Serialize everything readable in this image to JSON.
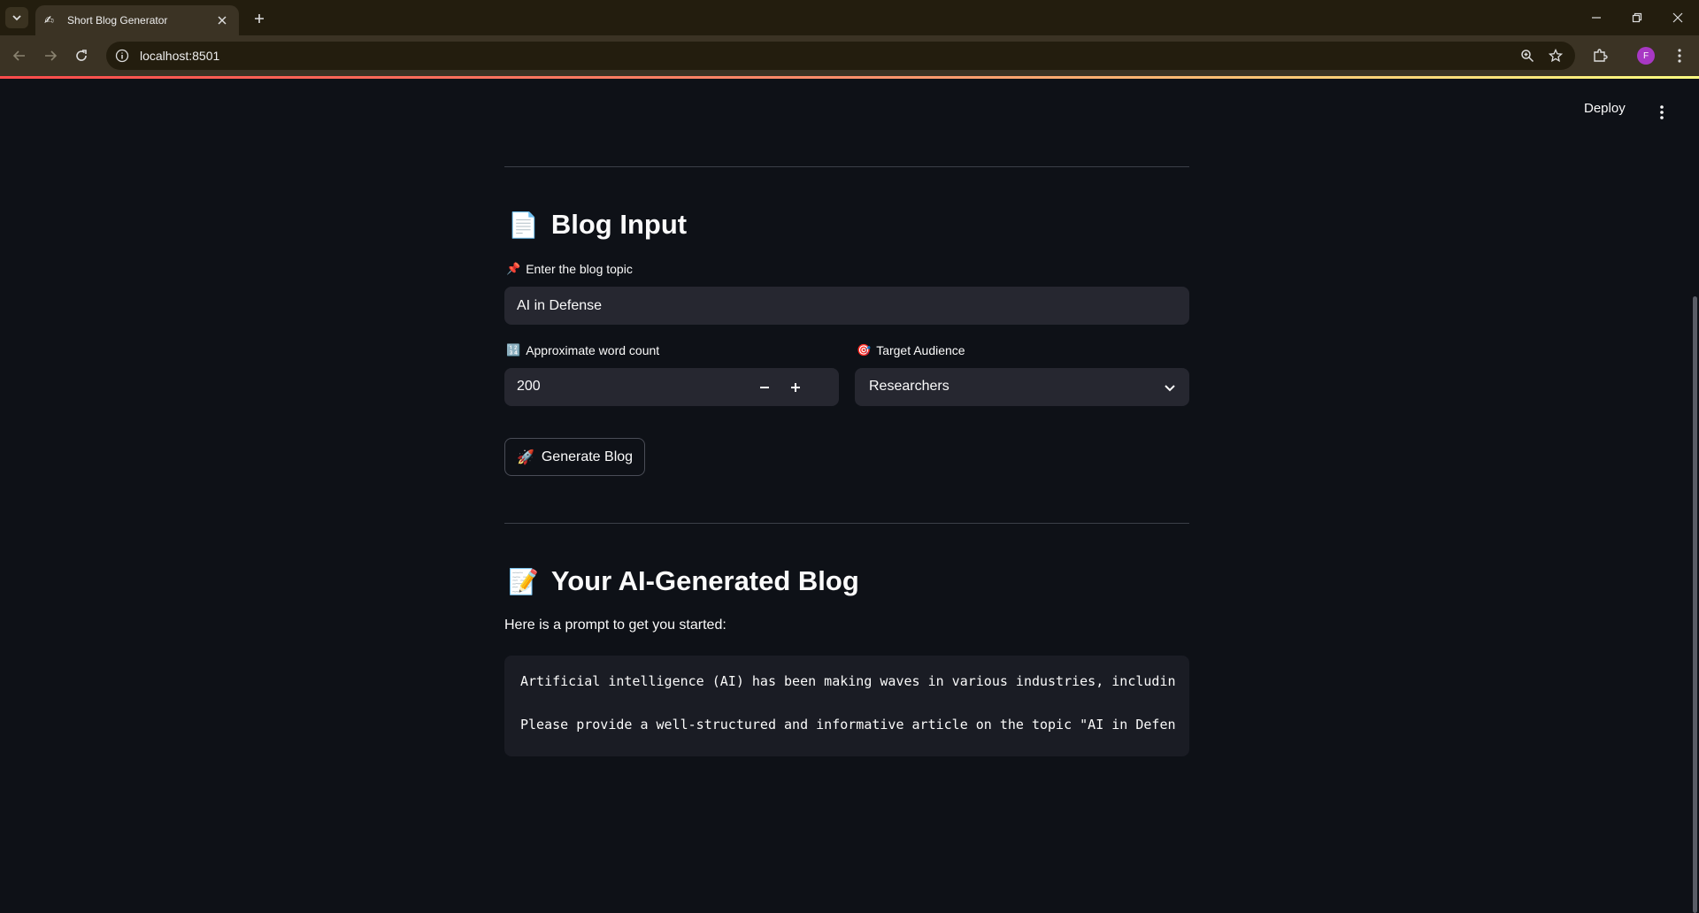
{
  "browser": {
    "tab_title": "Short Blog Generator",
    "tab_favicon": "✍",
    "url": "localhost:8501",
    "profile_initial": "F"
  },
  "header": {
    "deploy_label": "Deploy"
  },
  "input_section": {
    "title_emoji": "📄",
    "title": "Blog Input",
    "topic_label_emoji": "📌",
    "topic_label": "Enter the blog topic",
    "topic_value": "AI in Defense",
    "word_count_label_emoji": "🔢",
    "word_count_label": "Approximate word count",
    "word_count_value": "200",
    "audience_label_emoji": "🎯",
    "audience_label": "Target Audience",
    "audience_value": "Researchers",
    "generate_emoji": "🚀",
    "generate_label": "Generate Blog"
  },
  "output_section": {
    "title_emoji": "📝",
    "title": "Your AI-Generated Blog",
    "intro": "Here is a prompt to get you started:",
    "code_lines": [
      "Artificial intelligence (AI) has been making waves in various industries, includin",
      "Please provide a well-structured and informative article on the topic \"AI in Defen"
    ]
  },
  "icons": {
    "tab_list": "chevron-down-icon",
    "close": "close-icon",
    "new_tab": "plus-icon",
    "back": "back-arrow-icon",
    "forward": "forward-arrow-icon",
    "reload": "reload-icon",
    "site_info": "info-icon",
    "zoom": "zoom-icon",
    "bookmark": "star-icon",
    "extensions": "puzzle-icon",
    "menu": "kebab-menu-icon"
  },
  "colors": {
    "background": "#0e1117",
    "input_bg": "#262730",
    "accent_gradient_start": "#ff4b4b",
    "accent_gradient_end": "#fffd80",
    "profile": "#a838c4"
  }
}
